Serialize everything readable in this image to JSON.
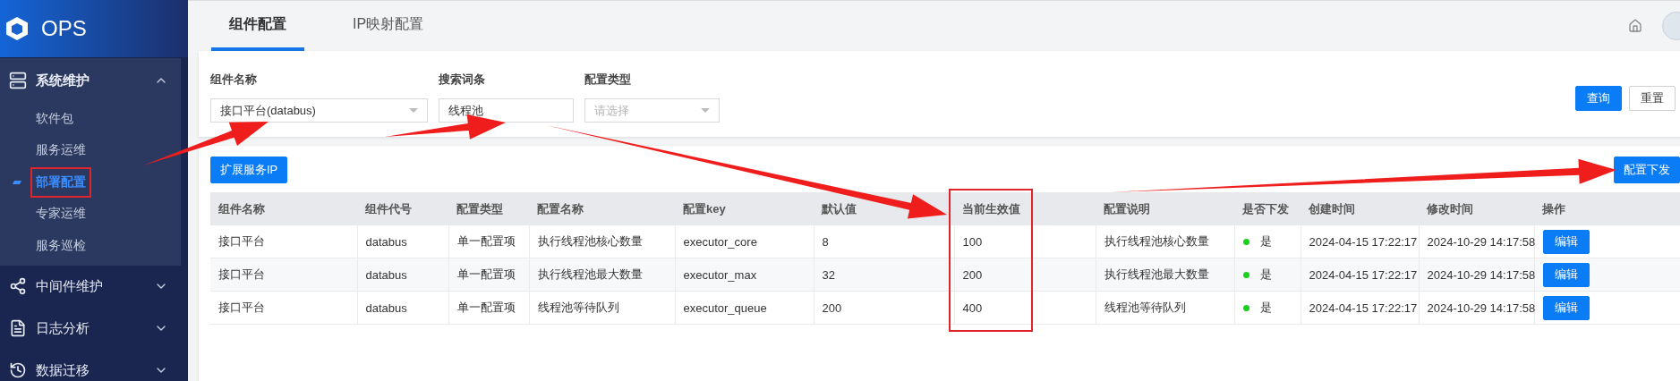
{
  "sidebar": {
    "logo": "OPS",
    "groups": [
      {
        "label": "系统维护",
        "expanded": true,
        "children": [
          {
            "label": "软件包",
            "selected": false,
            "highlighted": false
          },
          {
            "label": "服务运维",
            "selected": false,
            "highlighted": false
          },
          {
            "label": "部署配置",
            "selected": true,
            "highlighted": true
          },
          {
            "label": "专家运维",
            "selected": false,
            "highlighted": false
          },
          {
            "label": "服务巡检",
            "selected": false,
            "highlighted": false
          }
        ]
      },
      {
        "label": "中间件维护",
        "expanded": false
      },
      {
        "label": "日志分析",
        "expanded": false
      },
      {
        "label": "数据迁移",
        "expanded": false
      }
    ]
  },
  "tabs": [
    {
      "label": "组件配置",
      "selected": true
    },
    {
      "label": "IP映射配置",
      "selected": false
    }
  ],
  "filters": [
    {
      "label": "组件名称",
      "kind": "select",
      "value": "接口平台(databus)"
    },
    {
      "label": "搜索词条",
      "kind": "input",
      "value": "线程池"
    },
    {
      "label": "配置类型",
      "kind": "select",
      "placeholder": "请选择"
    }
  ],
  "filter_buttons": [
    {
      "label": "查询",
      "primary": true
    },
    {
      "label": "重置",
      "primary": false
    }
  ],
  "toolbar": {
    "left_button": "扩展服务IP",
    "right_button": "配置下发"
  },
  "table": {
    "columns": [
      {
        "label": "组件名称",
        "highlighted": false
      },
      {
        "label": "组件代号",
        "highlighted": false
      },
      {
        "label": "配置类型",
        "highlighted": false
      },
      {
        "label": "配置名称",
        "highlighted": false
      },
      {
        "label": "配置key",
        "highlighted": false
      },
      {
        "label": "默认值",
        "highlighted": false
      },
      {
        "label": "当前生效值",
        "highlighted": true
      },
      {
        "label": "配置说明",
        "highlighted": false
      },
      {
        "label": "是否下发",
        "highlighted": false
      },
      {
        "label": "创建时间",
        "highlighted": false
      },
      {
        "label": "修改时间",
        "highlighted": false
      },
      {
        "label": "操作",
        "highlighted": false
      }
    ],
    "rows": [
      {
        "cells": [
          {
            "kind": "text",
            "text": "接口平台"
          },
          {
            "kind": "text",
            "text": "databus"
          },
          {
            "kind": "text",
            "text": "单一配置项"
          },
          {
            "kind": "text",
            "text": "执行线程池核心数量"
          },
          {
            "kind": "text",
            "text": "executor_core"
          },
          {
            "kind": "text",
            "text": "8"
          },
          {
            "kind": "text",
            "text": "100"
          },
          {
            "kind": "text",
            "text": "执行线程池核心数量"
          },
          {
            "kind": "status",
            "text": "是",
            "color": "#19d11d"
          },
          {
            "kind": "text",
            "text": "2024-04-15 17:22:17"
          },
          {
            "kind": "text",
            "text": "2024-10-29 14:17:58"
          },
          {
            "kind": "button",
            "text": "编辑"
          }
        ]
      },
      {
        "cells": [
          {
            "kind": "text",
            "text": "接口平台"
          },
          {
            "kind": "text",
            "text": "databus"
          },
          {
            "kind": "text",
            "text": "单一配置项"
          },
          {
            "kind": "text",
            "text": "执行线程池最大数量"
          },
          {
            "kind": "text",
            "text": "executor_max"
          },
          {
            "kind": "text",
            "text": "32"
          },
          {
            "kind": "text",
            "text": "200"
          },
          {
            "kind": "text",
            "text": "执行线程池最大数量"
          },
          {
            "kind": "status",
            "text": "是",
            "color": "#19d11d"
          },
          {
            "kind": "text",
            "text": "2024-04-15 17:22:17"
          },
          {
            "kind": "text",
            "text": "2024-10-29 14:17:58"
          },
          {
            "kind": "button",
            "text": "编辑"
          }
        ]
      },
      {
        "cells": [
          {
            "kind": "text",
            "text": "接口平台"
          },
          {
            "kind": "text",
            "text": "databus"
          },
          {
            "kind": "text",
            "text": "单一配置项"
          },
          {
            "kind": "text",
            "text": "线程池等待队列"
          },
          {
            "kind": "text",
            "text": "executor_queue"
          },
          {
            "kind": "text",
            "text": "200"
          },
          {
            "kind": "text",
            "text": "400"
          },
          {
            "kind": "text",
            "text": "线程池等待队列"
          },
          {
            "kind": "status",
            "text": "是",
            "color": "#19d11d"
          },
          {
            "kind": "text",
            "text": "2024-04-15 17:22:17"
          },
          {
            "kind": "text",
            "text": "2024-10-29 14:17:58"
          },
          {
            "kind": "button",
            "text": "编辑"
          }
        ]
      }
    ]
  }
}
